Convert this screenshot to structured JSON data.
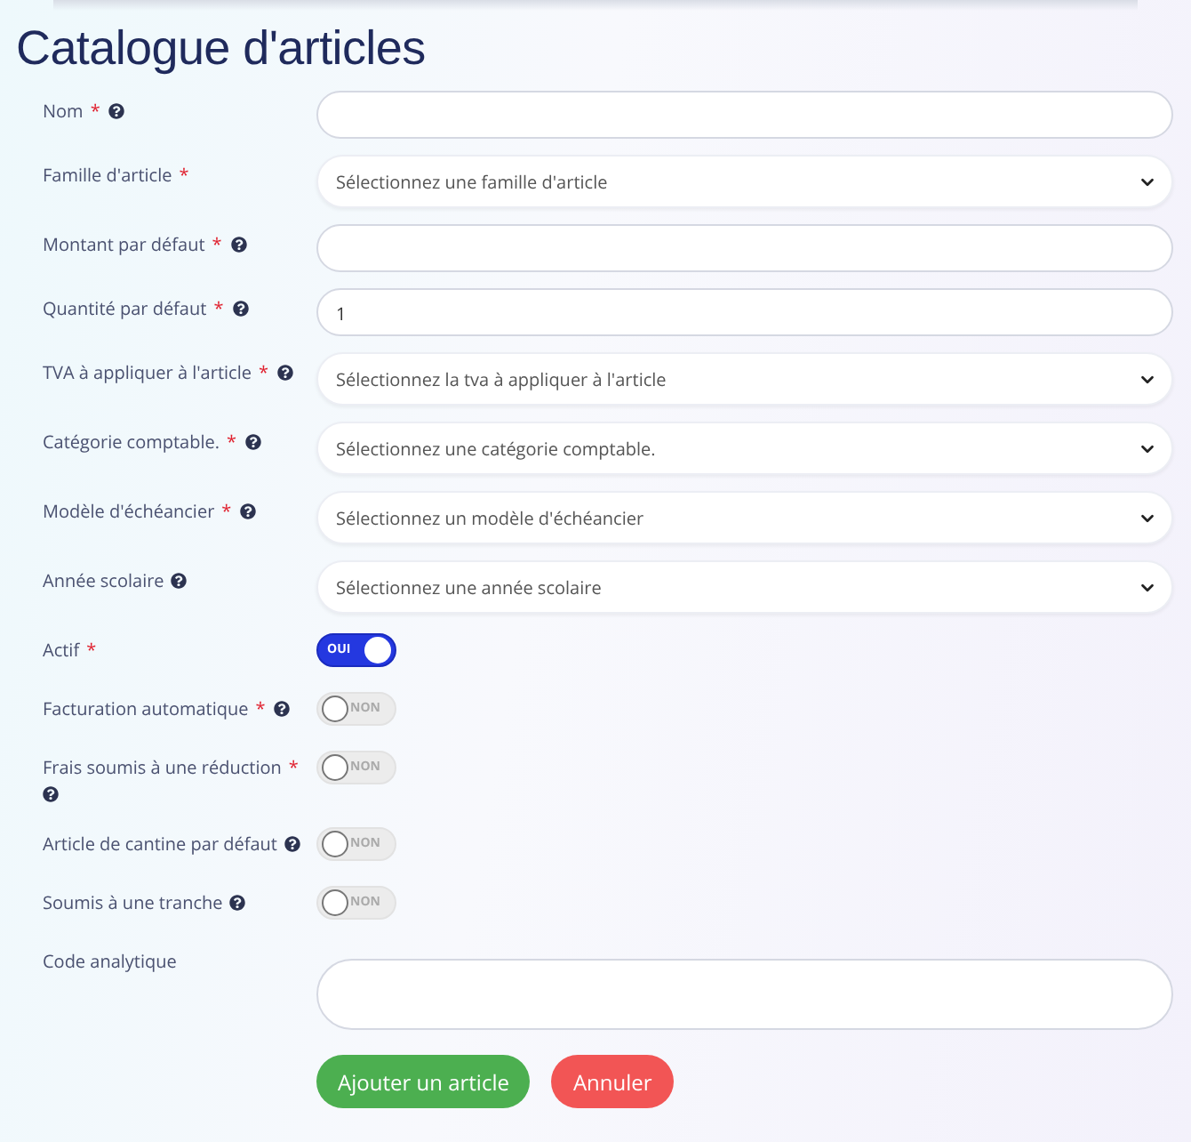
{
  "title": "Catalogue d'articles",
  "fields": [
    {
      "kind": "input",
      "label": "Nom",
      "required": "*",
      "help": true
    },
    {
      "kind": "select",
      "label": "Famille d'article",
      "required": "*",
      "help": false,
      "placeholder": "Sélectionnez une famille d'article"
    },
    {
      "kind": "input",
      "label": "Montant par défaut",
      "required": "*",
      "help": true
    },
    {
      "kind": "input",
      "label": "Quantité par défaut",
      "required": "*",
      "help": true,
      "value": "1"
    },
    {
      "kind": "select",
      "label": "TVA à appliquer à l'article",
      "required": "*",
      "help": true,
      "placeholder": "Sélectionnez la tva à appliquer à l'article"
    },
    {
      "kind": "select",
      "label": "Catégorie comptable.",
      "required": "*",
      "help": true,
      "placeholder": "Sélectionnez une catégorie comptable."
    },
    {
      "kind": "select",
      "label": "Modèle d'échéancier",
      "required": "*",
      "help": true,
      "placeholder": "Sélectionnez un modèle d'échéancier"
    },
    {
      "kind": "select",
      "label": "Année scolaire",
      "help": true,
      "placeholder": "Sélectionnez une année scolaire"
    },
    {
      "kind": "toggle",
      "label": "Actif",
      "required": "*",
      "help": false,
      "on": true,
      "text": "OUI"
    },
    {
      "kind": "toggle",
      "label": "Facturation automatique",
      "required": "*",
      "help": true,
      "on": false,
      "text": "NON"
    },
    {
      "kind": "toggle",
      "label": "Frais soumis à une réduction",
      "required": "*",
      "help": true,
      "on": false,
      "text": "NON"
    },
    {
      "kind": "toggle",
      "label": "Article de cantine par défaut",
      "help": true,
      "on": false,
      "text": "NON"
    },
    {
      "kind": "toggle",
      "label": "Soumis à une tranche",
      "help": true,
      "on": false,
      "text": "NON"
    },
    {
      "kind": "textarea",
      "label": "Code analytique",
      "help": false
    }
  ],
  "buttons": [
    {
      "kind": "primary",
      "label": "Ajouter un article"
    },
    {
      "kind": "danger",
      "label": "Annuler"
    }
  ]
}
